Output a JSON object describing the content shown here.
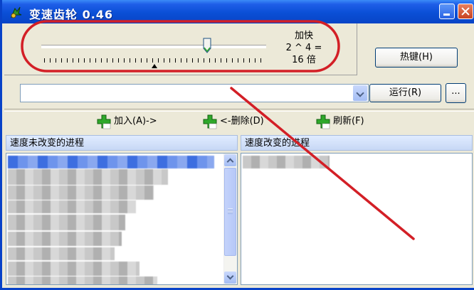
{
  "window": {
    "title": "变速齿轮 0.46"
  },
  "speed": {
    "line1": "加快",
    "line2": "2 ^ 4 =",
    "line3": "16 倍"
  },
  "buttons": {
    "hotkey": "热键(H)",
    "run": "运行(R)",
    "more": "..."
  },
  "actions": {
    "add": "加入(A)->",
    "remove": "<-删除(D)",
    "refresh": "刷新(F)"
  },
  "panels": {
    "left_header": "速度未改变的进程",
    "right_header": "速度改变的进程"
  },
  "colors": {
    "titlebar": "#0a4fd6",
    "annotation_red": "#d31f26",
    "action_icon": "#2fa82b"
  }
}
